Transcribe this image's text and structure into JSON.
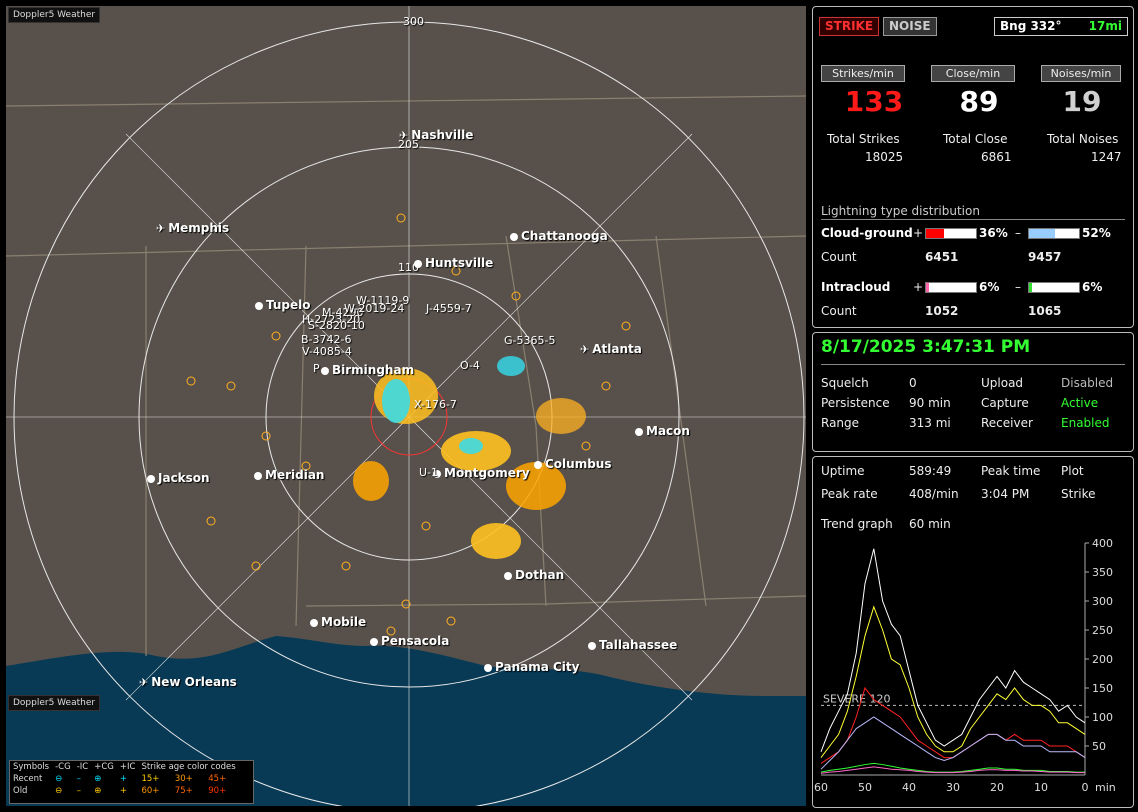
{
  "app_badge": "Doppler5 Weather",
  "range_labels": {
    "r300": "300",
    "r205": "205",
    "r110": "110"
  },
  "cities": [
    {
      "id": "nashville",
      "name": "Nashville",
      "type": "plane"
    },
    {
      "id": "memphis",
      "name": "Memphis",
      "type": "plane"
    },
    {
      "id": "chattanooga",
      "name": "Chattanooga",
      "type": "dot"
    },
    {
      "id": "huntsville",
      "name": "Huntsville",
      "type": "dot"
    },
    {
      "id": "tupelo",
      "name": "Tupelo",
      "type": "dot"
    },
    {
      "id": "atlanta",
      "name": "Atlanta",
      "type": "plane"
    },
    {
      "id": "birmingham",
      "name": "Birmingham",
      "type": "dot"
    },
    {
      "id": "macon",
      "name": "Macon",
      "type": "dot"
    },
    {
      "id": "jackson",
      "name": "Jackson",
      "type": "dot"
    },
    {
      "id": "meridian",
      "name": "Meridian",
      "type": "dot"
    },
    {
      "id": "montgomery",
      "name": "Montgomery",
      "type": "dot"
    },
    {
      "id": "columbus",
      "name": "Columbus",
      "type": "dot"
    },
    {
      "id": "dothan",
      "name": "Dothan",
      "type": "dot"
    },
    {
      "id": "mobile",
      "name": "Mobile",
      "type": "dot"
    },
    {
      "id": "pensacola",
      "name": "Pensacola",
      "type": "dot"
    },
    {
      "id": "tallahassee",
      "name": "Tallahassee",
      "type": "dot"
    },
    {
      "id": "panamacity",
      "name": "Panama City",
      "type": "dot"
    },
    {
      "id": "neworleans",
      "name": "New Orleans",
      "type": "plane"
    }
  ],
  "storm_labels": [
    "W-1119-9",
    "M-4290",
    "W-2019-24",
    "J-4559-7",
    "H-2723-20",
    "S-2820-10",
    "B-3742-6",
    "V-4085-4",
    "P",
    "G-5365-5",
    "O-4",
    "X-176-7",
    "U-1"
  ],
  "legend": {
    "symbols": "Symbols",
    "h_mcg": "-CG",
    "h_mic": "-IC",
    "h_pcg": "+CG",
    "h_pic": "+IC",
    "h_age": "Strike age color codes",
    "recent": "Recent",
    "old": "Old",
    "ages_recent": [
      "15+",
      "30+",
      "45+"
    ],
    "ages_old": [
      "60+",
      "75+",
      "90+"
    ]
  },
  "top": {
    "strike_btn": "STRIKE",
    "noise_btn": "NOISE",
    "bearing": "Bng 332°",
    "distance": "17mi"
  },
  "rates": {
    "strikes_label": "Strikes/min",
    "strikes_value": "133",
    "close_label": "Close/min",
    "close_value": "89",
    "noises_label": "Noises/min",
    "noises_value": "19",
    "total_strikes_label": "Total Strikes",
    "total_strikes": "18025",
    "total_close_label": "Total Close",
    "total_close": "6861",
    "total_noises_label": "Total Noises",
    "total_noises": "1247"
  },
  "distribution": {
    "title": "Lightning type distribution",
    "cg_label": "Cloud-ground",
    "cg_plus_pct": "36%",
    "cg_minus_pct": "52%",
    "cg_plus_frac": 0.36,
    "cg_minus_frac": 0.52,
    "count_label": "Count",
    "cg_plus_count": "6451",
    "cg_minus_count": "9457",
    "ic_label": "Intracloud",
    "ic_plus_pct": "6%",
    "ic_minus_pct": "6%",
    "ic_plus_frac": 0.06,
    "ic_minus_frac": 0.06,
    "ic_plus_count": "1052",
    "ic_minus_count": "1065",
    "plus": "+",
    "minus": "–"
  },
  "status": {
    "datetime": "8/17/2025 3:47:31 PM",
    "squelch_label": "Squelch",
    "squelch": "0",
    "upload_label": "Upload",
    "upload": "Disabled",
    "persistence_label": "Persistence",
    "persistence": "90 min",
    "capture_label": "Capture",
    "capture": "Active",
    "range_label": "Range",
    "range": "313 mi",
    "receiver_label": "Receiver",
    "receiver": "Enabled"
  },
  "stats": {
    "uptime_label": "Uptime",
    "uptime": "589:49",
    "peak_time_label": "Peak time",
    "peak_time": "3:04 PM",
    "plot_label": "Plot",
    "plot": "Strike",
    "peak_rate_label": "Peak rate",
    "peak_rate": "408/min",
    "trend_label": "Trend graph",
    "trend_value": "60 min",
    "severe": "SEVERE 120",
    "x_unit": "min"
  },
  "chart_data": {
    "type": "line",
    "xlabel": "min",
    "ylabel": "",
    "xlim": [
      60,
      0
    ],
    "ylim": [
      0,
      400
    ],
    "x_ticks": [
      60,
      50,
      40,
      30,
      20,
      10,
      0
    ],
    "y_ticks": [
      50,
      100,
      150,
      200,
      250,
      300,
      350,
      400
    ],
    "threshold": {
      "label": "SEVERE 120",
      "value": 120
    },
    "x": [
      60,
      58,
      56,
      54,
      52,
      50,
      48,
      46,
      44,
      42,
      40,
      38,
      36,
      34,
      32,
      30,
      28,
      26,
      24,
      22,
      20,
      18,
      16,
      14,
      12,
      10,
      8,
      6,
      4,
      2,
      0
    ],
    "series": [
      {
        "color": "#ffffff",
        "values": [
          40,
          80,
          110,
          140,
          210,
          330,
          390,
          300,
          260,
          240,
          180,
          120,
          90,
          60,
          50,
          60,
          70,
          100,
          130,
          150,
          170,
          150,
          180,
          160,
          150,
          140,
          130,
          110,
          120,
          100,
          90
        ]
      },
      {
        "color": "#ffff33",
        "values": [
          30,
          50,
          70,
          110,
          170,
          240,
          290,
          250,
          200,
          190,
          150,
          100,
          70,
          50,
          40,
          40,
          50,
          80,
          100,
          120,
          140,
          130,
          150,
          130,
          120,
          120,
          110,
          90,
          90,
          80,
          70
        ]
      },
      {
        "color": "#ff2222",
        "values": [
          20,
          30,
          40,
          60,
          100,
          150,
          130,
          120,
          110,
          100,
          80,
          60,
          50,
          40,
          30,
          30,
          40,
          50,
          60,
          70,
          70,
          60,
          70,
          60,
          60,
          60,
          50,
          50,
          50,
          40,
          30
        ]
      },
      {
        "color": "#bbbbff",
        "values": [
          10,
          25,
          40,
          60,
          80,
          90,
          100,
          90,
          80,
          70,
          60,
          50,
          40,
          30,
          25,
          30,
          40,
          50,
          60,
          70,
          70,
          60,
          60,
          50,
          50,
          50,
          40,
          40,
          40,
          40,
          30
        ]
      },
      {
        "color": "#33ff33",
        "values": [
          5,
          8,
          10,
          12,
          15,
          18,
          20,
          18,
          15,
          12,
          10,
          8,
          6,
          5,
          5,
          5,
          6,
          8,
          10,
          12,
          12,
          10,
          10,
          8,
          8,
          8,
          6,
          6,
          6,
          5,
          5
        ]
      },
      {
        "color": "#ff66cc",
        "values": [
          3,
          5,
          6,
          8,
          10,
          12,
          14,
          12,
          10,
          9,
          8,
          6,
          5,
          4,
          4,
          4,
          5,
          6,
          8,
          9,
          9,
          8,
          8,
          7,
          7,
          6,
          5,
          5,
          5,
          4,
          4
        ]
      }
    ]
  },
  "colors": {
    "strike_red": "#ff1a1a",
    "close_white": "#ffffff",
    "noise_gray": "#d0d0d0",
    "green": "#33ff33",
    "cg_plus": "#ff0000",
    "cg_minus": "#99ccff",
    "ic_plus": "#ff66aa",
    "ic_minus": "#33dd33"
  }
}
